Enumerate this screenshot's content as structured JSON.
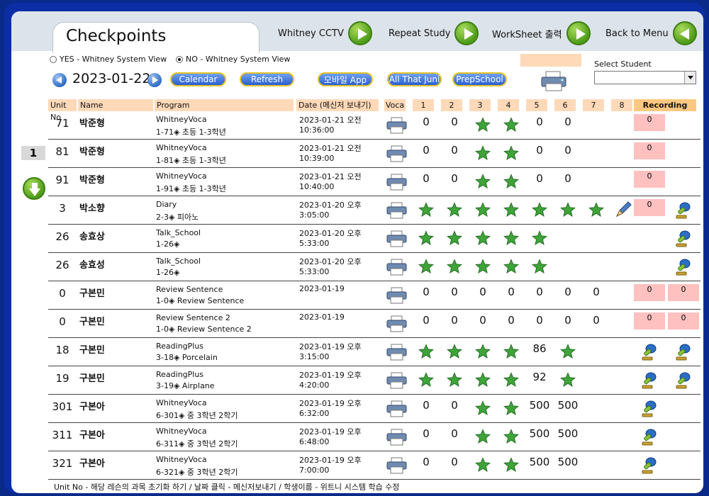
{
  "title": "Checkpoints",
  "nav": [
    {
      "label": "Whitney CCTV",
      "icon": "play-icon"
    },
    {
      "label": "Repeat Study",
      "icon": "play-icon"
    },
    {
      "label": "WorkSheet 출력",
      "icon": "play-icon"
    },
    {
      "label": "Back to Menu",
      "icon": "back-icon"
    }
  ],
  "view_options": [
    {
      "label": "YES - Whitney System View",
      "selected": false
    },
    {
      "label": "NO - Whitney System View",
      "selected": true
    }
  ],
  "date": "2023-01-22",
  "toolbar_buttons": [
    "Calendar",
    "Refresh",
    "모바일 App",
    "All That Juni",
    "PrepSchool"
  ],
  "select_student": {
    "label": "Select Student",
    "value": ""
  },
  "page_number": "1",
  "columns": {
    "unit": "Unit No",
    "name": "Name",
    "program": "Program",
    "date": "Date (메신저 보내기)",
    "voca": "Voca",
    "nums": [
      "1",
      "2",
      "3",
      "4",
      "5",
      "6",
      "7",
      "8"
    ],
    "recording": "Recording"
  },
  "rows": [
    {
      "unit": "71",
      "name": "박준형",
      "program": "WhitneyVoca",
      "detail": "1-71◈ 초등 1-3학년",
      "date": "2023-01-21 오전",
      "time": "10:36:00",
      "cells": [
        "0",
        "0",
        "star",
        "star",
        "0",
        "0",
        "",
        ""
      ],
      "pencil": false,
      "rec": [
        "0",
        ""
      ],
      "mic": [
        false,
        false
      ]
    },
    {
      "unit": "81",
      "name": "박준형",
      "program": "WhitneyVoca",
      "detail": "1-81◈ 초등 1-3학년",
      "date": "2023-01-21 오전",
      "time": "10:39:00",
      "cells": [
        "0",
        "0",
        "star",
        "star",
        "0",
        "0",
        "",
        ""
      ],
      "pencil": false,
      "rec": [
        "0",
        ""
      ],
      "mic": [
        false,
        false
      ]
    },
    {
      "unit": "91",
      "name": "박준형",
      "program": "WhitneyVoca",
      "detail": "1-91◈ 초등 1-3학년",
      "date": "2023-01-21 오전",
      "time": "10:40:00",
      "cells": [
        "0",
        "0",
        "star",
        "star",
        "0",
        "0",
        "",
        ""
      ],
      "pencil": false,
      "rec": [
        "0",
        ""
      ],
      "mic": [
        false,
        false
      ]
    },
    {
      "unit": "3",
      "name": "박소향",
      "program": "Diary",
      "detail": "2-3◈ 피아노",
      "date": "2023-01-20 오후",
      "time": "3:05:00",
      "cells": [
        "star",
        "star",
        "star",
        "star",
        "star",
        "star",
        "star",
        ""
      ],
      "pencil": true,
      "rec": [
        "0",
        ""
      ],
      "mic": [
        false,
        true
      ]
    },
    {
      "unit": "26",
      "name": "송효상",
      "program": "Talk_School",
      "detail": "1-26◈",
      "date": "2023-01-20 오후",
      "time": "5:33:00",
      "cells": [
        "star",
        "star",
        "star",
        "star",
        "star",
        "",
        "",
        ""
      ],
      "pencil": false,
      "rec": [
        "",
        ""
      ],
      "mic": [
        false,
        true
      ]
    },
    {
      "unit": "26",
      "name": "송효성",
      "program": "Talk_School",
      "detail": "1-26◈",
      "date": "2023-01-20 오후",
      "time": "5:33:00",
      "cells": [
        "star",
        "star",
        "star",
        "star",
        "star",
        "",
        "",
        ""
      ],
      "pencil": false,
      "rec": [
        "",
        ""
      ],
      "mic": [
        false,
        true
      ]
    },
    {
      "unit": "0",
      "name": "구본민",
      "program": "Review Sentence",
      "detail": "1-0◈ Review Sentence",
      "date": "2023-01-19",
      "time": "",
      "cells": [
        "0",
        "0",
        "0",
        "0",
        "0",
        "0",
        "0",
        ""
      ],
      "pencil": false,
      "rec": [
        "0",
        "0"
      ],
      "mic": [
        false,
        false
      ]
    },
    {
      "unit": "0",
      "name": "구본민",
      "program": "Review Sentence 2",
      "detail": "1-0◈ Review Sentence 2",
      "date": "2023-01-19",
      "time": "",
      "cells": [
        "0",
        "0",
        "0",
        "0",
        "0",
        "0",
        "0",
        ""
      ],
      "pencil": false,
      "rec": [
        "0",
        "0"
      ],
      "mic": [
        false,
        false
      ]
    },
    {
      "unit": "18",
      "name": "구본민",
      "program": "ReadingPlus",
      "detail": "3-18◈ Porcelain",
      "date": "2023-01-19 오후",
      "time": "3:15:00",
      "cells": [
        "star",
        "star",
        "star",
        "star",
        "86",
        "star",
        "",
        ""
      ],
      "pencil": false,
      "rec": [
        "",
        ""
      ],
      "mic": [
        true,
        true
      ]
    },
    {
      "unit": "19",
      "name": "구본민",
      "program": "ReadingPlus",
      "detail": "3-19◈ Airplane",
      "date": "2023-01-19 오후",
      "time": "4:20:00",
      "cells": [
        "star",
        "star",
        "star",
        "star",
        "92",
        "star",
        "",
        ""
      ],
      "pencil": false,
      "rec": [
        "",
        ""
      ],
      "mic": [
        true,
        true
      ]
    },
    {
      "unit": "301",
      "name": "구본아",
      "program": "WhitneyVoca",
      "detail": "6-301◈ 중 3학년 2학기",
      "date": "2023-01-19 오후",
      "time": "6:32:00",
      "cells": [
        "0",
        "0",
        "star",
        "star",
        "500",
        "500",
        "",
        ""
      ],
      "pencil": false,
      "rec": [
        "",
        ""
      ],
      "mic": [
        true,
        false
      ]
    },
    {
      "unit": "311",
      "name": "구본아",
      "program": "WhitneyVoca",
      "detail": "6-311◈ 중 3학년 2학기",
      "date": "2023-01-19 오후",
      "time": "6:48:00",
      "cells": [
        "0",
        "0",
        "star",
        "star",
        "500",
        "500",
        "",
        ""
      ],
      "pencil": false,
      "rec": [
        "",
        ""
      ],
      "mic": [
        true,
        false
      ]
    },
    {
      "unit": "321",
      "name": "구본아",
      "program": "WhitneyVoca",
      "detail": "6-321◈ 중 3학년 2학기",
      "date": "2023-01-19 오후",
      "time": "7:00:00",
      "cells": [
        "0",
        "0",
        "star",
        "star",
        "500",
        "500",
        "",
        ""
      ],
      "pencil": false,
      "rec": [
        "",
        ""
      ],
      "mic": [
        true,
        false
      ]
    }
  ],
  "footer": "Unit No - 해당 레슨의 과목 초기화 하기 / 날짜 클릭 - 메신저보내기  /  학생이름 - 위트니 시스템 학습 수정",
  "colors": {
    "frame": "#0b2ea6",
    "header_cell": "#ffd9b8",
    "recording_header": "#ffc880",
    "rec_cell": "#ffc0c0",
    "star": "#3fa33a"
  }
}
